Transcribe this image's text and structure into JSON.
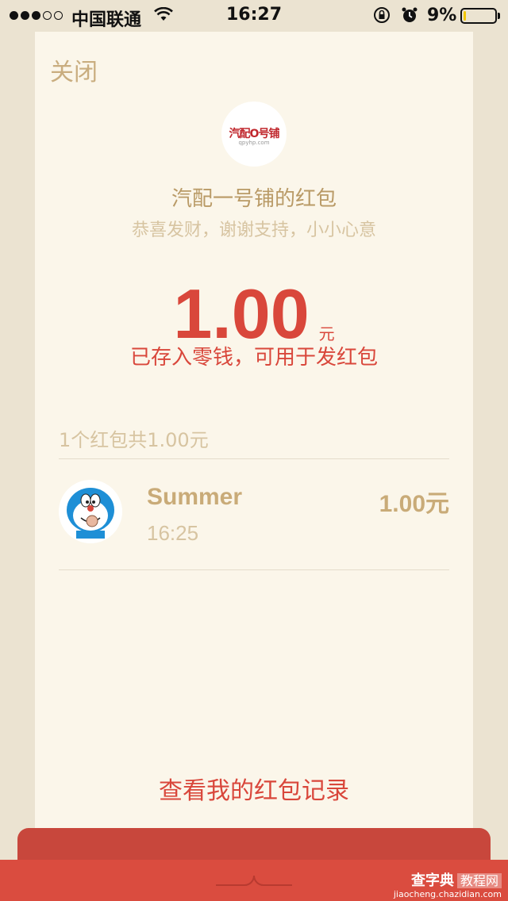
{
  "status_bar": {
    "carrier": "中国联通",
    "time": "16:27",
    "battery_percent": "9%",
    "battery_level": 0.09,
    "icons": [
      "signal-icon",
      "wifi-icon",
      "rotation-lock-icon",
      "alarm-icon",
      "battery-icon"
    ]
  },
  "card": {
    "close_label": "关闭",
    "logo_text": "汽配O号铺",
    "logo_sub": "qpyhp.com",
    "sender_title": "汽配一号铺的红包",
    "blessing": "恭喜发财，谢谢支持，小小心意",
    "amount": "1.00",
    "currency": "元",
    "saved_note": "已存入零钱，可用于发红包",
    "summary": "1个红包共1.00元",
    "records": [
      {
        "name": "Summer",
        "time": "16:25",
        "amount": "1.00元",
        "avatar": "doraemon-avatar"
      }
    ],
    "history_link": "查看我的红包记录"
  },
  "watermark": {
    "main": "查字典",
    "sub": "教程网",
    "url": "jiaocheng.chazidian.com"
  },
  "colors": {
    "background": "#ebe3d1",
    "card": "#fbf6ea",
    "accent_red": "#d9473b",
    "gold_text": "#b99a66",
    "light_gold": "#d7c4a1",
    "envelope_red": "#da4c3f"
  }
}
